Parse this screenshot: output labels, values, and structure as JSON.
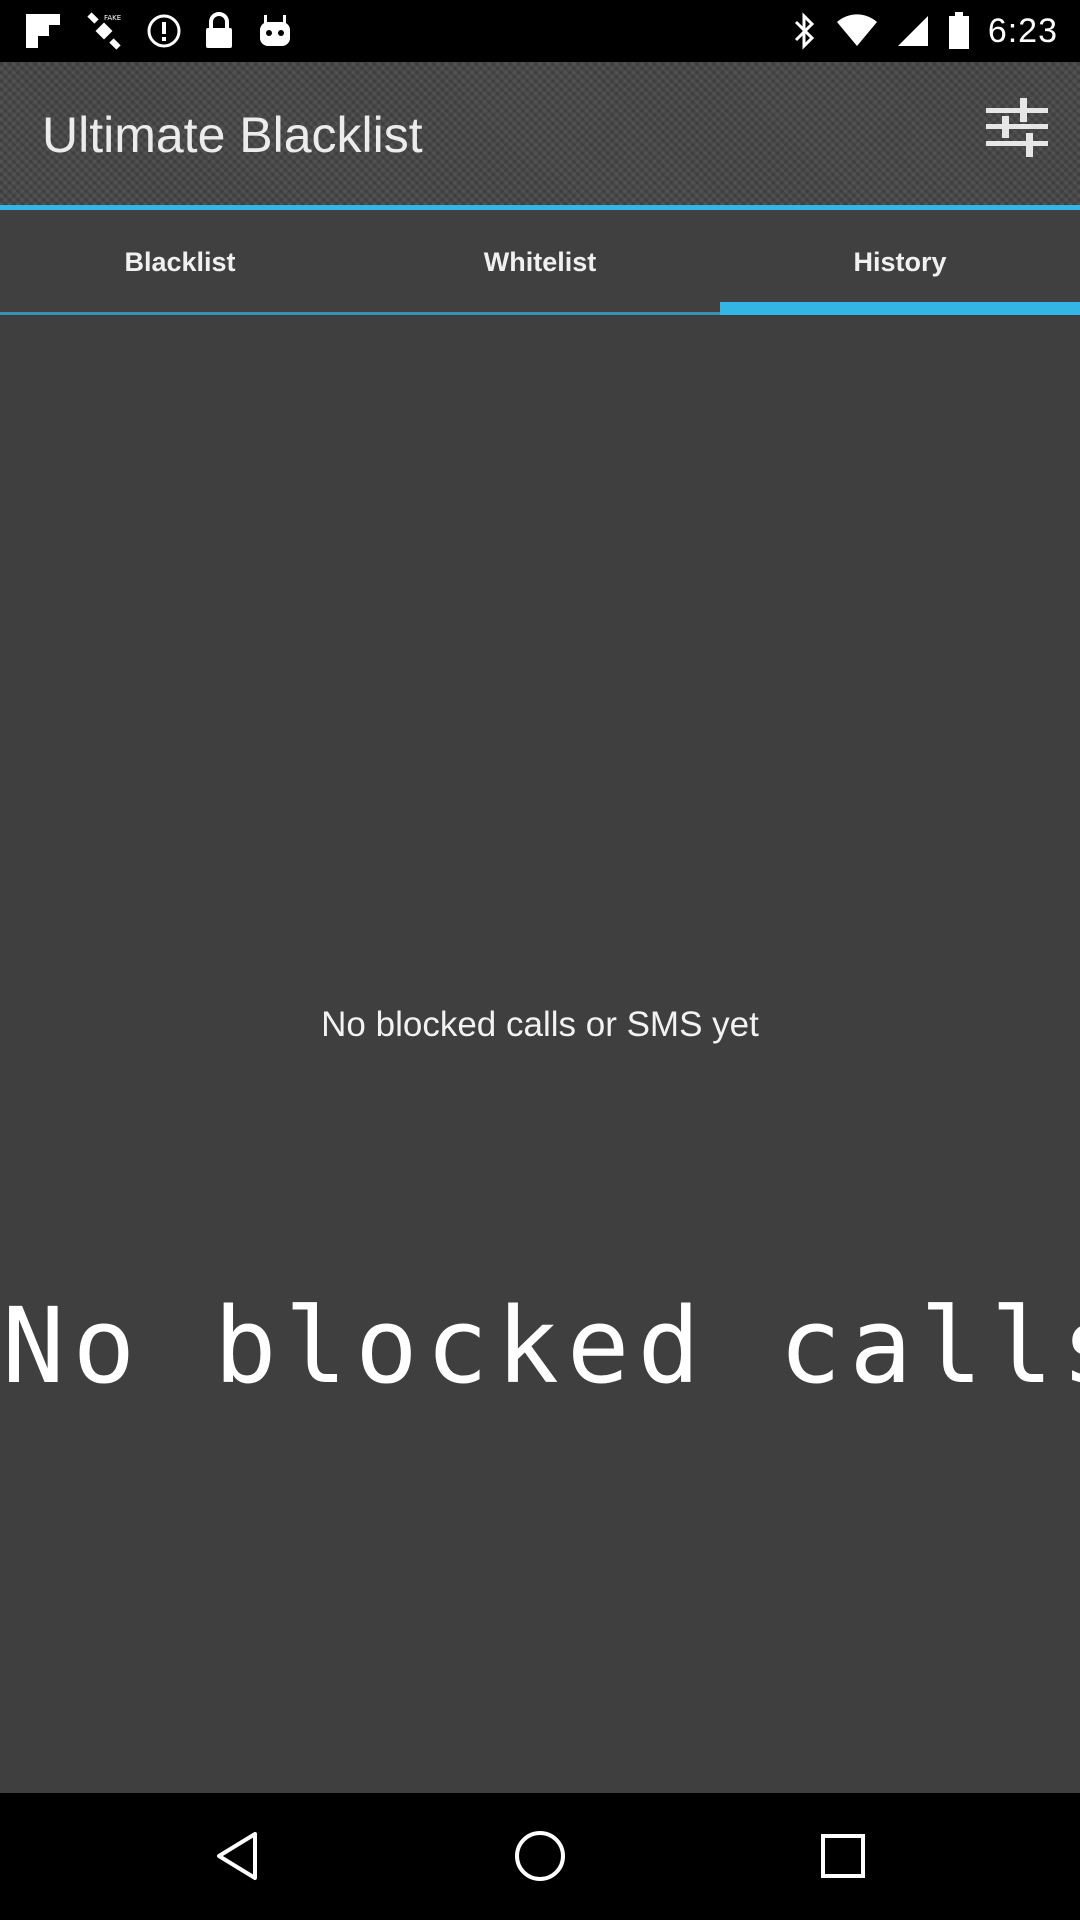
{
  "status_bar": {
    "time": "6:23",
    "left_icons": [
      "flipboard-icon",
      "fake-gps-icon",
      "info-icon",
      "lock-icon",
      "android-icon"
    ],
    "right_icons": [
      "bluetooth-icon",
      "wifi-icon",
      "signal-icon",
      "battery-icon"
    ]
  },
  "app": {
    "title": "Ultimate Blacklist",
    "settings_icon": "sliders-icon"
  },
  "tabs": [
    {
      "label": "Blacklist",
      "selected": false
    },
    {
      "label": "Whitelist",
      "selected": false
    },
    {
      "label": "History",
      "selected": true
    }
  ],
  "content": {
    "empty_message": "No blocked calls or SMS yet",
    "large_message": "No blocked calls or SM"
  },
  "nav_bar": {
    "icons": [
      "back-icon",
      "home-icon",
      "recents-icon"
    ]
  },
  "colors": {
    "accent": "#33b5e5",
    "background": "#3f3f3f",
    "system_bars": "#000000"
  }
}
